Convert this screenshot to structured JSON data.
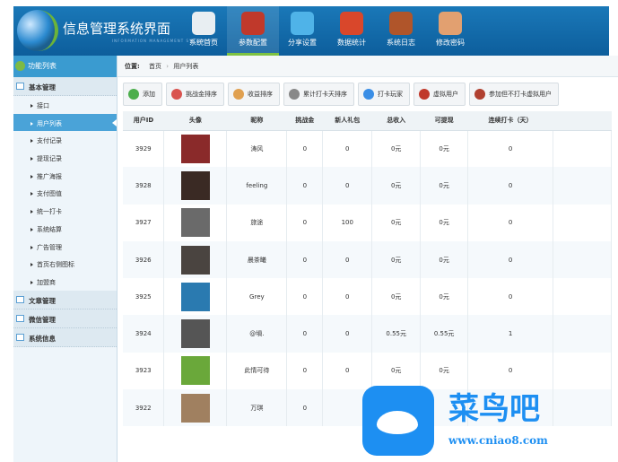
{
  "header": {
    "title": "信息管理系统界面",
    "subtitle": "INFORMATION MANAGEMENT SYSTEM GUI",
    "nav": [
      {
        "label": "系统首页",
        "color": "#e8eef2"
      },
      {
        "label": "参数配置",
        "color": "#c0392b"
      },
      {
        "label": "分享设置",
        "color": "#4fb3e8"
      },
      {
        "label": "数据统计",
        "color": "#d9472b"
      },
      {
        "label": "系统日志",
        "color": "#b0552a"
      },
      {
        "label": "修改密码",
        "color": "#e2a070"
      }
    ]
  },
  "sidebar": {
    "title": "功能列表",
    "groups": [
      "基本管理",
      "文章管理",
      "微信管理",
      "系统信息"
    ],
    "items": [
      "接口",
      "用户列表",
      "支付记录",
      "提现记录",
      "推广海报",
      "支付图值",
      "统一打卡",
      "系统结算",
      "广告管理",
      "首页右侧图标",
      "加盟商"
    ]
  },
  "breadcrumb": {
    "label": "位置:",
    "home": "首页",
    "sep": "›",
    "current": "用户列表"
  },
  "toolbar": [
    {
      "label": "添加",
      "color": "#4cae4c"
    },
    {
      "label": "挑战金排序",
      "color": "#d9534f"
    },
    {
      "label": "收益排序",
      "color": "#e0a050"
    },
    {
      "label": "累计打卡天排序",
      "color": "#888888"
    },
    {
      "label": "打卡玩家",
      "color": "#3a8ee6"
    },
    {
      "label": "虚拟用户",
      "color": "#c0392b"
    },
    {
      "label": "参加但不打卡虚拟用户",
      "color": "#b04030"
    }
  ],
  "table": {
    "headers": [
      "用户ID",
      "头像",
      "昵称",
      "挑战金",
      "新人礼包",
      "总收入",
      "可提现",
      "连续打卡（天）",
      ""
    ],
    "rows": [
      {
        "id": "3929",
        "name": "涛风",
        "c": "0",
        "g": "0",
        "t": "0元",
        "w": "0元",
        "d": "0",
        "av": "#8a2a2a"
      },
      {
        "id": "3928",
        "name": "feeling",
        "c": "0",
        "g": "0",
        "t": "0元",
        "w": "0元",
        "d": "0",
        "av": "#3a2a24"
      },
      {
        "id": "3927",
        "name": "旅途",
        "c": "0",
        "g": "100",
        "t": "0元",
        "w": "0元",
        "d": "0",
        "av": "#6a6a6a"
      },
      {
        "id": "3926",
        "name": "晨茶曦",
        "c": "0",
        "g": "0",
        "t": "0元",
        "w": "0元",
        "d": "0",
        "av": "#4a4440"
      },
      {
        "id": "3925",
        "name": "Grey",
        "c": "0",
        "g": "0",
        "t": "0元",
        "w": "0元",
        "d": "0",
        "av": "#2a7ab0"
      },
      {
        "id": "3924",
        "name": "@塤.",
        "c": "0",
        "g": "0",
        "t": "0.55元",
        "w": "0.55元",
        "d": "1",
        "av": "#555555"
      },
      {
        "id": "3923",
        "name": "此情可待",
        "c": "0",
        "g": "0",
        "t": "0元",
        "w": "0元",
        "d": "0",
        "av": "#6aa83a"
      },
      {
        "id": "3922",
        "name": "万琪",
        "c": "0",
        "g": "",
        "t": "",
        "w": "",
        "d": "",
        "av": "#a08060"
      }
    ]
  },
  "watermark": {
    "text": "菜鸟吧",
    "url": "www.cniao8.com"
  }
}
